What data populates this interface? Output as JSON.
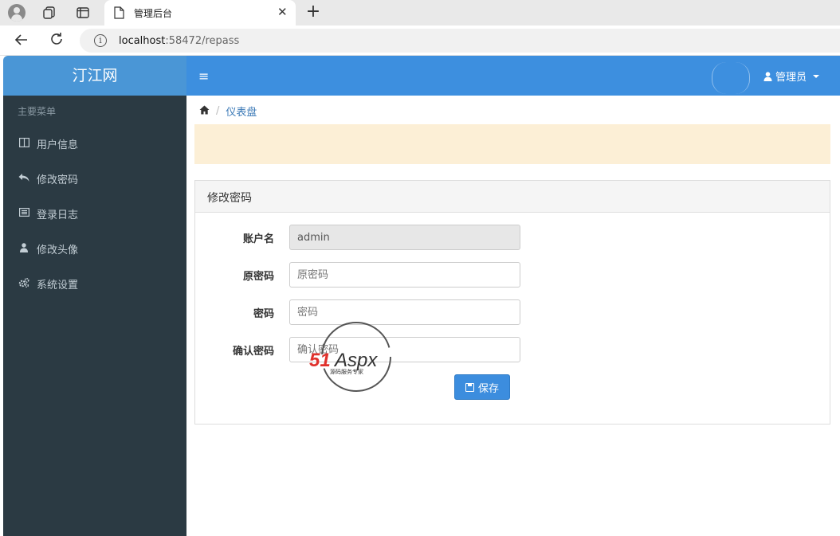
{
  "browser": {
    "tab_title": "管理后台",
    "tab_close": "✕",
    "new_tab": "+",
    "url_host": "localhost",
    "url_rest": ":58472/repass",
    "info_glyph": "i",
    "icons": [
      "profile-icon",
      "workspaces-icon",
      "tab-actions-icon",
      "page-icon",
      "back-icon",
      "reload-icon",
      "info-icon"
    ]
  },
  "app": {
    "brand": "汀江网",
    "user_menu": "管理员",
    "hamburger_glyph": "≡",
    "colors": {
      "brand": "#4a96d6",
      "topbar": "#3d8fdf",
      "sidebar": "#2b3a43",
      "alert": "#fcefd6",
      "button": "#3c8dde"
    }
  },
  "sidebar": {
    "header": "主要菜单",
    "items": [
      {
        "label": "用户信息",
        "icon": "columns-icon",
        "glyph": "◫"
      },
      {
        "label": "修改密码",
        "icon": "reply-all-icon",
        "glyph": "↶"
      },
      {
        "label": "登录日志",
        "icon": "list-alt-icon",
        "glyph": "☰"
      },
      {
        "label": "修改头像",
        "icon": "user-icon",
        "glyph": "●"
      },
      {
        "label": "系统设置",
        "icon": "cogs-icon",
        "glyph": "⚙"
      }
    ]
  },
  "breadcrumb": {
    "home_glyph": "⌂",
    "separator": "/",
    "current": "仪表盘"
  },
  "form": {
    "title": "修改密码",
    "fields": [
      {
        "label": "账户名",
        "value": "admin",
        "placeholder": "",
        "readonly": true
      },
      {
        "label": "原密码",
        "value": "",
        "placeholder": "原密码"
      },
      {
        "label": "密码",
        "value": "",
        "placeholder": "密码"
      },
      {
        "label": "确认密码",
        "value": "",
        "placeholder": "确认密码"
      }
    ],
    "save_label": "保存"
  },
  "watermark": {
    "brand": "51Aspx",
    "tagline": "源码服务专家"
  }
}
